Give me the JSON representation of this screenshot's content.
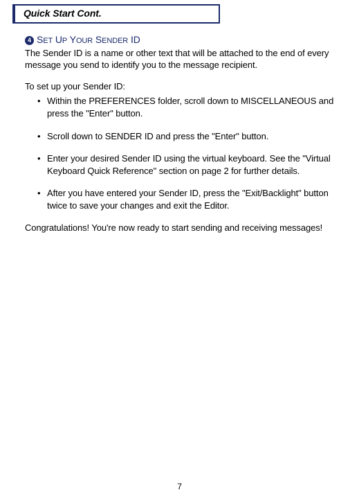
{
  "header": {
    "tab_title": "Quick Start Cont."
  },
  "step": {
    "number_glyph": "4",
    "heading_pre": "S",
    "heading_rest1": "et ",
    "heading_u": "U",
    "heading_rest2": "p ",
    "heading_y": "Y",
    "heading_rest3": "our ",
    "heading_s2": "S",
    "heading_rest4": "ender ",
    "heading_id": "ID",
    "heading_full": "Set Up Your Sender ID"
  },
  "para1": "The Sender ID is a name or other text that will be attached to the end of every message you send to identify you to the message recipient.",
  "para2": "To set up your Sender ID:",
  "bullets": [
    "Within the PREFERENCES folder, scroll down to MISCELLANEOUS and press the \"Enter\" button.",
    "Scroll down to SENDER ID and press the \"Enter\" button.",
    "Enter your desired Sender ID using the virtual keyboard.  See the \"Virtual Keyboard Quick Reference\" section on page 2 for further details.",
    "After you have entered your Sender ID, press the \"Exit/Backlight\" button twice to save your changes and exit the Editor."
  ],
  "para3": "Congratulations!  You're now ready to start sending and receiving messages!",
  "page_number": "7"
}
